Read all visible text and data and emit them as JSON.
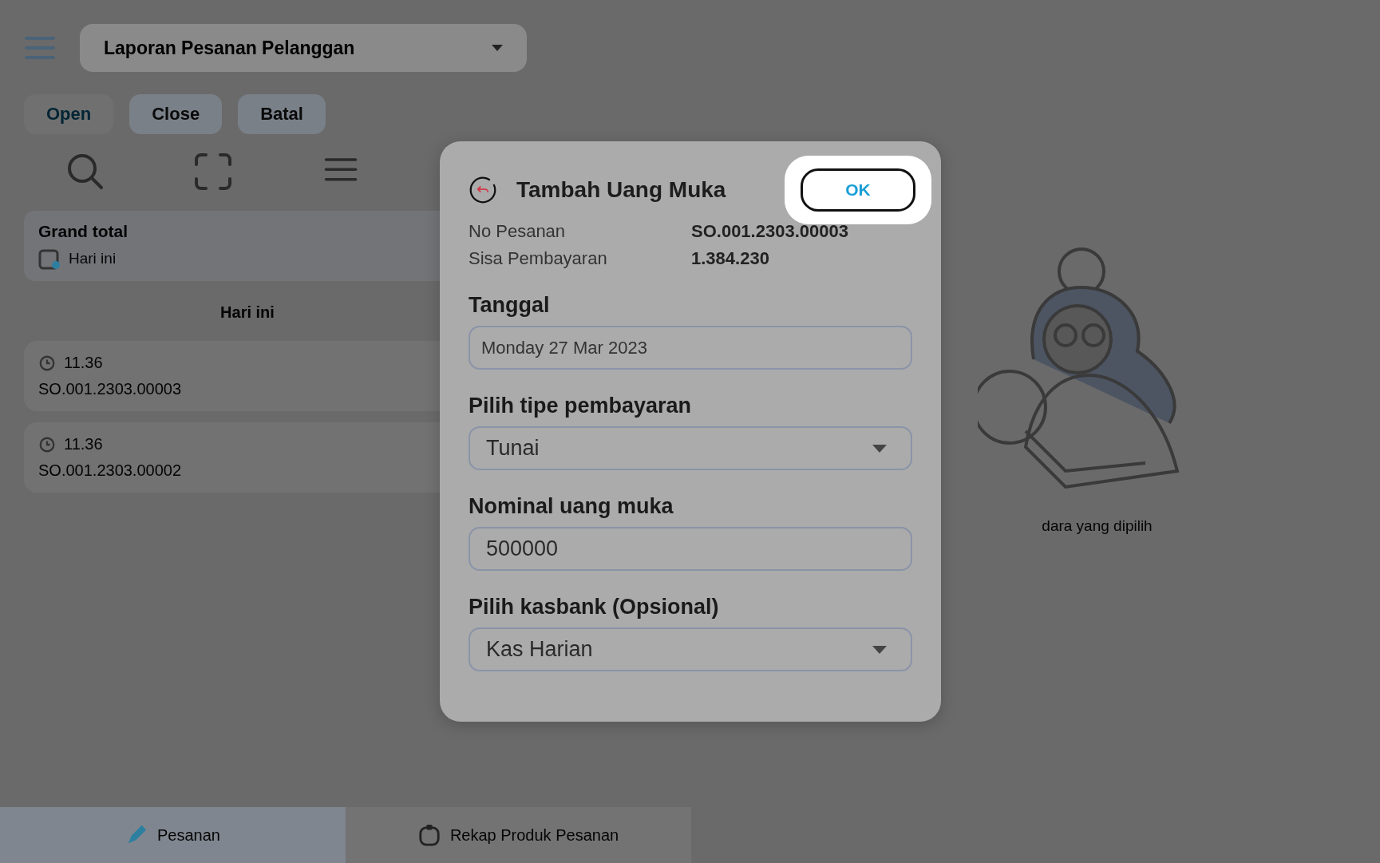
{
  "app_bar": {
    "report_select": {
      "value": "Laporan Pesanan Pelanggan"
    }
  },
  "tabs": [
    {
      "label": "Open",
      "selected": true
    },
    {
      "label": "Close",
      "selected": false
    },
    {
      "label": "Batal",
      "selected": false
    }
  ],
  "summary": {
    "title": "Grand total",
    "period": "Hari ini"
  },
  "section_header": "Hari ini",
  "orders": [
    {
      "time": "11.36",
      "number": "SO.001.2303.00003"
    },
    {
      "time": "11.36",
      "number": "SO.001.2303.00002"
    }
  ],
  "empty_state": {
    "message": "dara yang dipilih"
  },
  "bottom_nav": [
    {
      "label": "Pesanan",
      "selected": true
    },
    {
      "label": "Rekap Produk Pesanan",
      "selected": false
    }
  ],
  "dialog": {
    "title": "Tambah Uang Muka",
    "ok_button": {
      "label": "OK",
      "highlighted": true
    },
    "info": [
      {
        "label": "No Pesanan",
        "value": "SO.001.2303.00003"
      },
      {
        "label": "Sisa Pembayaran",
        "value": "1.384.230"
      }
    ],
    "fields": [
      {
        "label": "Tanggal",
        "kind": "date",
        "value": "Monday 27 Mar 2023"
      },
      {
        "label": "Pilih tipe pembayaran",
        "kind": "select",
        "value": "Tunai"
      },
      {
        "label": "Nominal uang muka",
        "kind": "number",
        "value": "500000"
      },
      {
        "label": "Pilih kasbank (Opsional)",
        "kind": "select",
        "value": "Kas Harian"
      }
    ]
  }
}
